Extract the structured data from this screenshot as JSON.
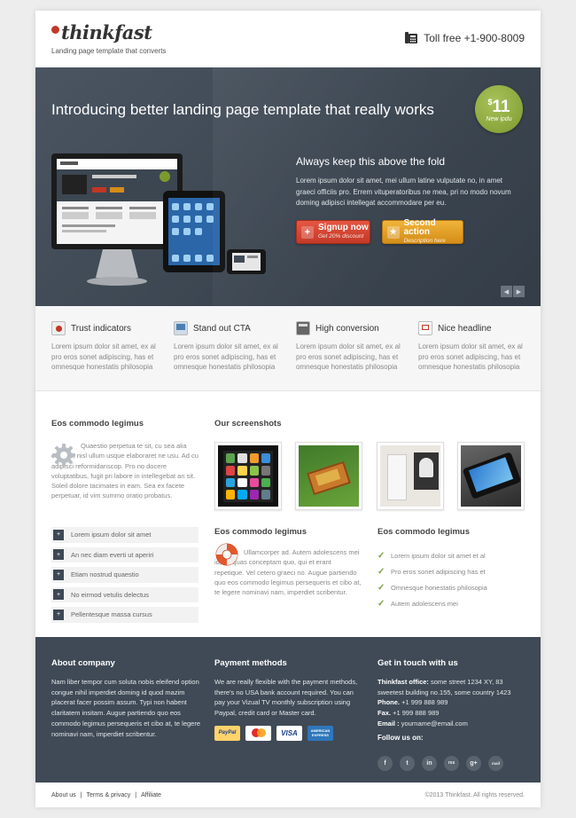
{
  "header": {
    "logo_text": "thinkfast",
    "tagline": "Landing page template that converts",
    "phone": "Toll free +1-900-8009"
  },
  "hero": {
    "title": "Introducing better landing page template that really works",
    "price_symbol": "$",
    "price_value": "11",
    "price_note": "New ipdu",
    "fold_title": "Always keep this above the fold",
    "fold_text": "Lorem ipsum dolor sit amet, mei ullum latine vulputate no, in amet graeci officiis pro. Errem vituperatoribus ne mea, pri no modo novum doming adipisci intellegat accommodare per eu.",
    "primary_button": {
      "label": "Signup now",
      "sub": "Get 20% discount"
    },
    "secondary_button": {
      "label": "Second action",
      "sub": "Description here"
    }
  },
  "features": [
    {
      "title": "Trust indicators",
      "icon": "trust-icon",
      "text": "Lorem ipsum dolor sit amet, ex al pro eros sonet adipiscing, has et omnesque honestatis philosopia"
    },
    {
      "title": "Stand out CTA",
      "icon": "monitor-icon",
      "text": "Lorem ipsum dolor sit amet, ex al pro eros sonet adipiscing, has et omnesque honestatis philosopia"
    },
    {
      "title": "High conversion",
      "icon": "calculator-icon",
      "text": "Lorem ipsum dolor sit amet, ex al pro eros sonet adipiscing, has et omnesque honestatis philosopia"
    },
    {
      "title": "Nice headline",
      "icon": "presentation-icon",
      "text": "Lorem ipsum dolor sit amet, ex al pro eros sonet adipiscing, has et omnesque honestatis philosopia"
    }
  ],
  "left": {
    "title": "Eos commodo legimus",
    "text": "Quaestio perpetua te sit, cu sea alia ceteros, nisl ullum usque elaboraret ne usu. Ad cu adipisci reformidanscop. Pro no docere voluptatibus, fugit pri labore in intellegebat an sit. Soleil dolore tacimates in eam. Sea ex facete perpetuar, id vim summo oratio probatus.",
    "list": [
      "Lorem ipsum dolor sit amet",
      "An nec diam everti ut aperiri",
      "Etiam nostrud quaestio",
      "No eirmod vetulis delectus",
      "Pellentesque massa cursus"
    ]
  },
  "screens": {
    "title": "Our screenshots"
  },
  "mid": {
    "title": "Eos commodo legimus",
    "text": "Ullamcorper ad. Autem adolescens mei id, an quas conceptam quo, qui et erant repetique. Vel cetero graeci no. Augue partiendo quo eos commodo legimus persequeris et cibo at, te legere nominavi nam, imperdiet scribentur."
  },
  "right": {
    "title": "Eos commodo legimus",
    "list": [
      "Lorem ipsum dolor sit amet et al",
      "Pro eros sonet adipiscing has et",
      "Omnesque honestatis philosopia",
      "Autem adolescens mei"
    ]
  },
  "footer": {
    "about_title": "About company",
    "about_text": "Nam liber tempor cum soluta nobis eleifend option congue nihil imperdiet doming id quod mazim placerat facer possim assum. Typi non habent claritatem insitam. Augue partiendo quo eos commodo legimus persequeris et cibo at, te legere nominavi nam, imperdiet scribentur.",
    "payment_title": "Payment methods",
    "payment_text": "We are really flexible with the payment methods, there's no USA bank account required. You can pay your Vizual TV monthly subscription using Paypal, credit card or Master card.",
    "cards": [
      "PayPal",
      "MasterCard",
      "VISA",
      "AMERICAN EXPRESS"
    ],
    "contact_title": "Get in touch with us",
    "office_label": "Thinkfast office:",
    "office_value": "some street 1234 XY, 83 sweetest building no.155, some country 1423",
    "phone_label": "Phone.",
    "phone_value": "+1 999 888 989",
    "fax_label": "Fax.",
    "fax_value": "+1 999 888 989",
    "email_label": "Email :",
    "email_value": "yourname@email.com",
    "follow": "Follow us on:",
    "socials": [
      "f",
      "t",
      "in",
      "rss",
      "g+",
      "mail"
    ]
  },
  "bottom": {
    "links": [
      "About us",
      "Terms & privacy",
      "Affiliate"
    ],
    "separator": "|",
    "copyright": "©2013 Thinkfast. All rights reserved."
  },
  "colors": {
    "hero_bg": "#3c4651",
    "footer_bg": "#3f4a56",
    "accent_red": "#c23624",
    "accent_orange": "#d48d18",
    "badge_green": "#7b9a2e"
  }
}
